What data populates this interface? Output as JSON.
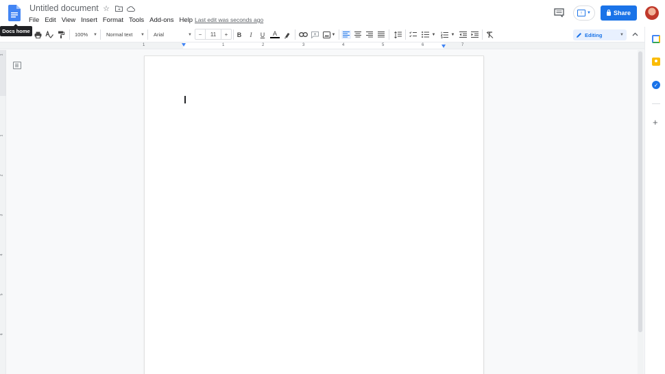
{
  "header": {
    "doc_title": "Untitled document",
    "menu": [
      "File",
      "Edit",
      "View",
      "Insert",
      "Format",
      "Tools",
      "Add-ons",
      "Help"
    ],
    "last_edit": "Last edit was seconds ago",
    "share_label": "Share",
    "tooltip": "Docs home"
  },
  "toolbar": {
    "zoom": "100%",
    "style": "Normal text",
    "font": "Arial",
    "font_size": "11",
    "minus": "−",
    "plus": "+",
    "bold": "B",
    "italic": "I",
    "underline": "U",
    "text_color_label": "A",
    "text_color": "#000000",
    "mode": "Editing"
  },
  "ruler": {
    "labels": [
      "1",
      "1",
      "2",
      "3",
      "4",
      "5",
      "6",
      "7"
    ],
    "vlabels": [
      "1",
      "1",
      "2",
      "3",
      "4",
      "5",
      "6"
    ]
  },
  "colors": {
    "accent": "#1a73e8",
    "editing_bg": "#e8f0fe"
  }
}
